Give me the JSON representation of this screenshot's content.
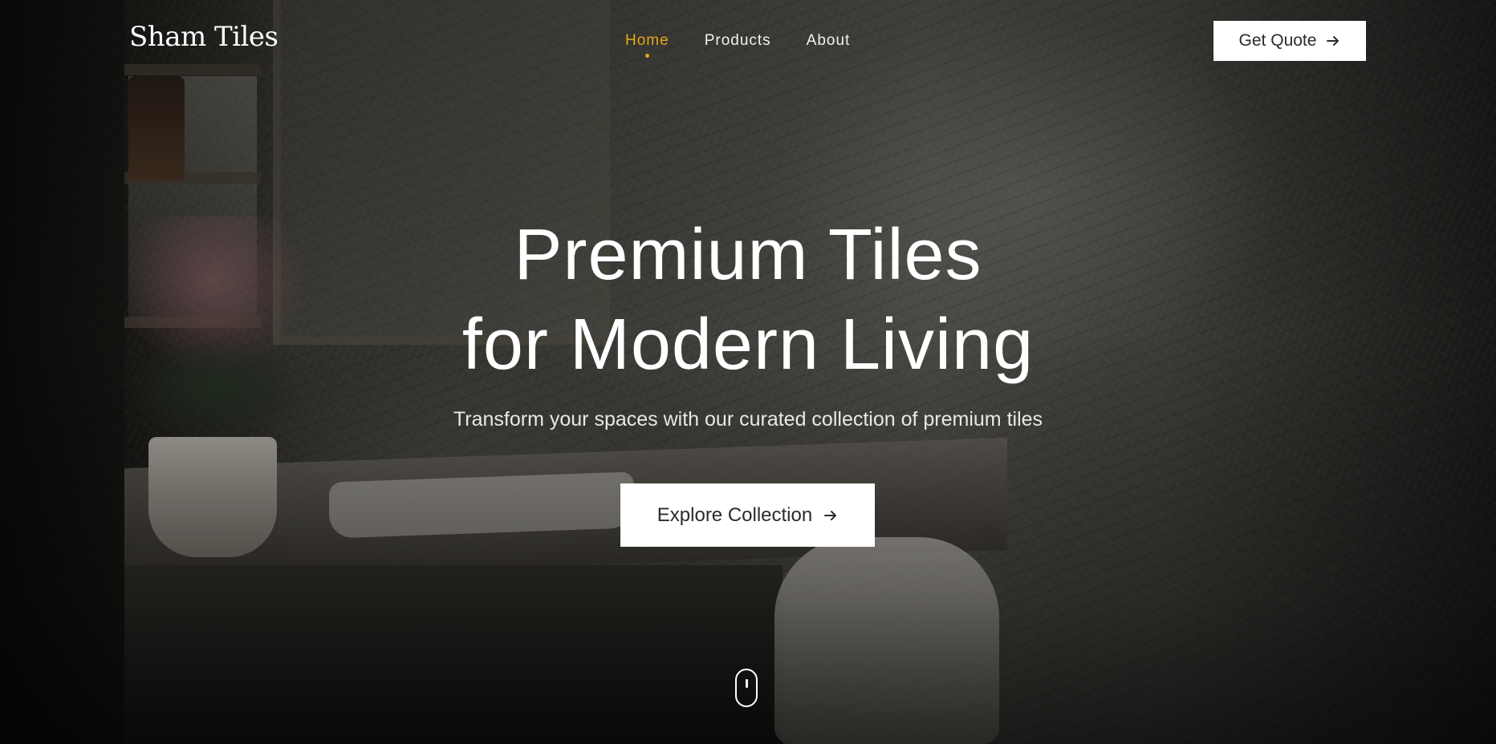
{
  "brand": {
    "name": "Sham Tiles",
    "accent": "#e6a817"
  },
  "nav": {
    "items": [
      {
        "label": "Home",
        "active": true
      },
      {
        "label": "Products",
        "active": false
      },
      {
        "label": "About",
        "active": false
      }
    ],
    "cta_label": "Get Quote",
    "cta_icon": "arrow-right-icon"
  },
  "hero": {
    "headline_line1": "Premium Tiles",
    "headline_line2": "for Modern Living",
    "subtitle": "Transform your spaces with our curated collection of premium tiles",
    "button_label": "Explore Collection",
    "button_icon": "arrow-right-icon",
    "scroll_icon": "mouse-scroll-icon"
  }
}
